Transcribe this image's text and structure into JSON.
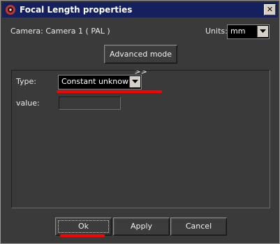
{
  "window": {
    "title": "Focal Length properties"
  },
  "camera": {
    "label": "Camera: Camera 1  ( PAL )"
  },
  "units": {
    "label": "Units:",
    "value": "mm"
  },
  "advanced_button": "Advanced mode >>",
  "type": {
    "label": "Type:",
    "value": "Constant unknown"
  },
  "value_field": {
    "label": "value:",
    "value": ""
  },
  "buttons": {
    "ok": "Ok",
    "apply": "Apply",
    "cancel": "Cancel"
  },
  "colors": {
    "titlebar": "#14215e",
    "background": "#3a3a3a",
    "annotation": "#ff0000"
  }
}
